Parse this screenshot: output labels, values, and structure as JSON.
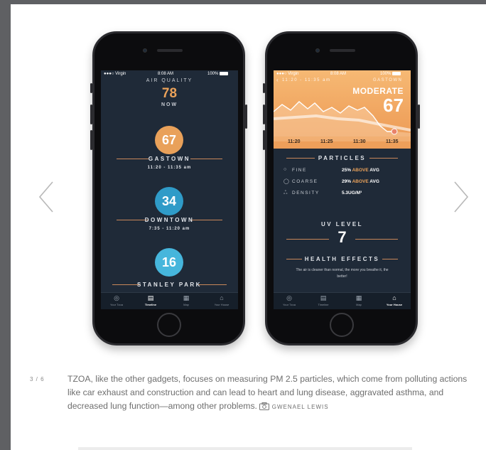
{
  "slide": {
    "counter": "3 / 6",
    "caption": "TZOA, like the other gadgets, focuses on measuring PM 2.5 particles, which come from polluting actions like car exhaust and construction and can lead to heart and lung disease, aggravated asthma, and decreased lung function—among other problems.",
    "credit": "GWENAEL LEWIS",
    "prev_icon": "chevron-left-icon",
    "next_icon": "chevron-right-icon"
  },
  "status_bar": {
    "carrier": "●●●○ Virgin",
    "time": "8:08 AM",
    "battery": "100%"
  },
  "phone_a": {
    "header_label": "AIR QUALITY",
    "header_value": "78",
    "header_sub": "NOW",
    "locations": [
      {
        "value": "67",
        "name": "GASTOWN",
        "time": "11:20 - 11:35 am",
        "color": "#e9a15a"
      },
      {
        "value": "34",
        "name": "DOWNTOWN",
        "time": "7:35 - 11:20 am",
        "color": "#2f9bc8"
      },
      {
        "value": "16",
        "name": "STANLEY PARK",
        "time": "",
        "color": "#46b6dc"
      }
    ],
    "tabs": [
      {
        "label": "Your Tzoa",
        "icon": "gauge-icon"
      },
      {
        "label": "Timeline",
        "icon": "timeline-icon"
      },
      {
        "label": "Map",
        "icon": "map-icon"
      },
      {
        "label": "Your House",
        "icon": "house-icon"
      }
    ],
    "active_tab": 1
  },
  "phone_b": {
    "top_time": "11:20 - 11:35 am",
    "top_location": "GASTOWN",
    "level": "MODERATE",
    "value": "67",
    "ticks": [
      "11:20",
      "11:25",
      "11:30",
      "11:35"
    ],
    "particles_title": "PARTICLES",
    "particles": [
      {
        "icon": "fine-particle-icon",
        "glyph": "○",
        "name": "FINE",
        "pct": "25%",
        "above": "ABOVE",
        "avg": "AVG"
      },
      {
        "icon": "coarse-particle-icon",
        "glyph": "◯",
        "name": "COARSE",
        "pct": "29%",
        "above": "ABOVE",
        "avg": "AVG"
      },
      {
        "icon": "density-icon",
        "glyph": "ஃ",
        "name": "DENSITY",
        "pct": "5.3UG/M³",
        "above": "",
        "avg": ""
      }
    ],
    "uv_title": "UV LEVEL",
    "uv_value": "7",
    "health_title": "HEALTH EFFECTS",
    "health_text": "The air is cleaner than normal, the more you breathe it, the better!",
    "tabs": [
      {
        "label": "Your Tzoa",
        "icon": "gauge-icon"
      },
      {
        "label": "Timeline",
        "icon": "timeline-icon"
      },
      {
        "label": "Map",
        "icon": "map-icon"
      },
      {
        "label": "Your House",
        "icon": "house-icon"
      }
    ],
    "active_tab": 3
  },
  "colors": {
    "screen_bg": "#1f2a38",
    "accent_orange": "#e9a15a",
    "line_orange": "#c8875a",
    "card_bg": "#ffffff",
    "outer_bg": "#5f6063"
  }
}
